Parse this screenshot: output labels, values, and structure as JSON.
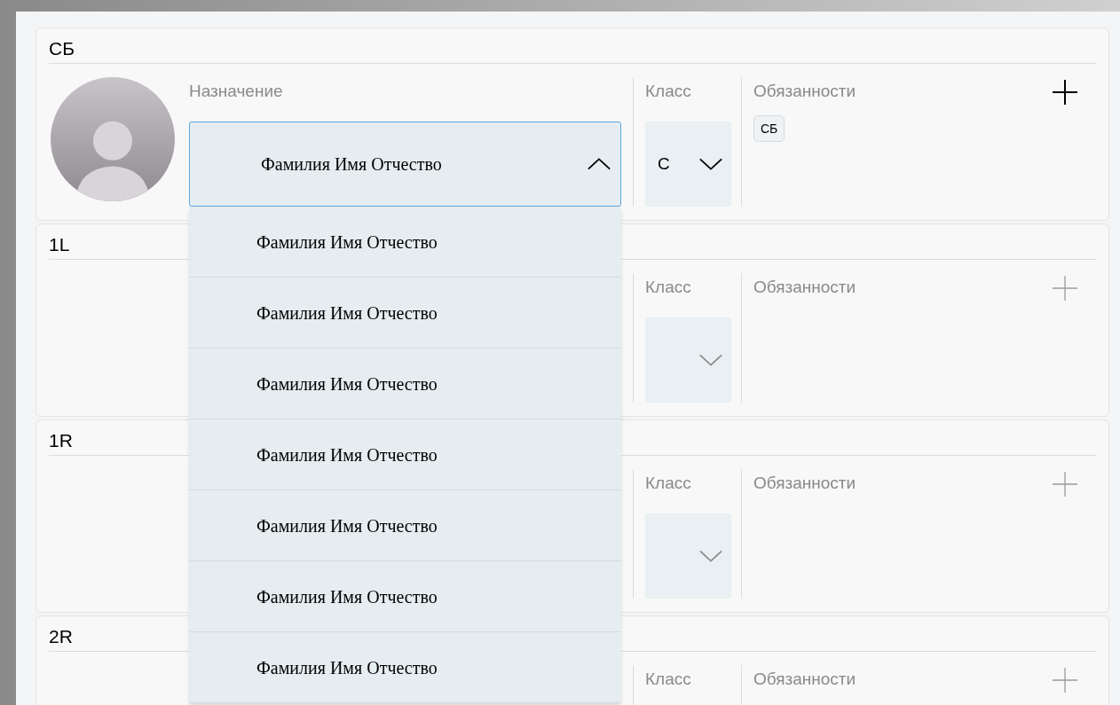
{
  "cards": [
    {
      "title": "СБ",
      "has_avatar": true,
      "assignment": {
        "label": "Назначение",
        "value": "Фамилия Имя Отчество",
        "expanded": true
      },
      "class": {
        "label": "Класс",
        "value": "С"
      },
      "duties": {
        "label": "Обязанности",
        "tags": [
          "СБ"
        ],
        "add_enabled": true
      }
    },
    {
      "title": "1L",
      "has_avatar": false,
      "class": {
        "label": "Класс"
      },
      "duties": {
        "label": "Обязанности",
        "add_enabled": false
      }
    },
    {
      "title": "1R",
      "has_avatar": false,
      "class": {
        "label": "Класс"
      },
      "duties": {
        "label": "Обязанности",
        "add_enabled": false
      }
    },
    {
      "title": "2R",
      "has_avatar": false,
      "class": {
        "label": "Класс"
      },
      "duties": {
        "label": "Обязанности",
        "add_enabled": false
      }
    }
  ],
  "dropdown_options": [
    "Фамилия Имя Отчество",
    "Фамилия Имя Отчество",
    "Фамилия Имя Отчество",
    "Фамилия Имя Отчество",
    "Фамилия Имя Отчество",
    "Фамилия Имя Отчество",
    "Фамилия Имя Отчество"
  ]
}
